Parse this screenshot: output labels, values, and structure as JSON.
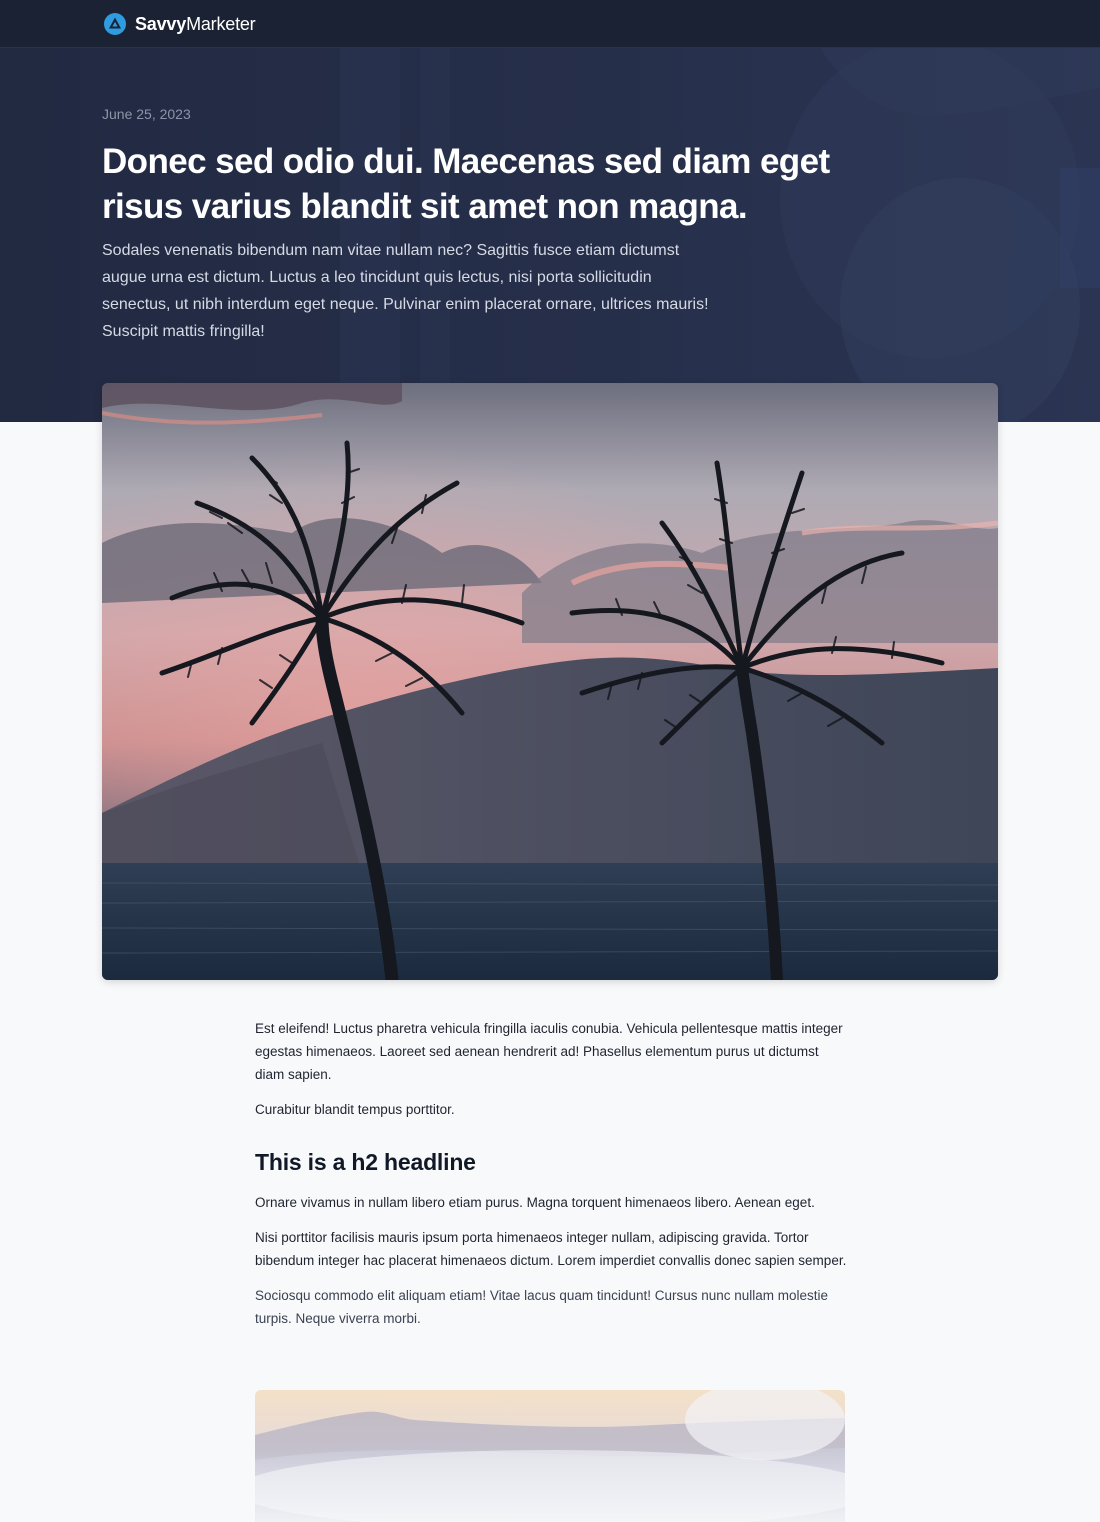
{
  "nav": {
    "brand_strong": "Savvy",
    "brand_light": "Marketer",
    "logo_icon": "triangle-circle-logo",
    "brand_color": "#2f9be0"
  },
  "hero": {
    "date": "June 25, 2023",
    "title": "Donec sed odio dui. Maecenas sed diam eget risus varius blandit sit amet non magna.",
    "excerpt": "Sodales venenatis bibendum nam vitae nullam nec? Sagittis fusce etiam dictumst augue urna est dictum. Luctus a leo tincidunt quis lectus, nisi porta sollicitudin senectus, ut nibh interdum eget neque. Pulvinar enim placerat ornare, ultrices mauris! Suscipit mattis fringilla!",
    "background_color": "#232c45"
  },
  "featured_image": {
    "subject": "palm-trees-sunset-photo"
  },
  "article": {
    "p1": "Est eleifend! Luctus pharetra vehicula fringilla iaculis conubia. Vehicula pellentesque mattis integer egestas himenaeos. Laoreet sed aenean hendrerit ad! Phasellus elementum purus ut dictumst diam sapien.",
    "p2": "Curabitur blandit tempus porttitor.",
    "h2": "This is a h2 headline",
    "p3": "Ornare vivamus in nullam libero etiam purus. Magna torquent himenaeos libero. Aenean eget.",
    "p4": "Nisi porttitor facilisis mauris ipsum porta himenaeos integer nullam, adipiscing gravida. Tortor bibendum integer hac placerat himenaeos dictum. Lorem imperdiet convallis donec sapien semper.",
    "p5": "Sociosqu commodo elit aliquam etiam! Vitae lacus quam tincidunt! Cursus nunc nullam molestie turpis. Neque viverra morbi."
  },
  "second_image": {
    "subject": "misty-mountain-photo"
  }
}
